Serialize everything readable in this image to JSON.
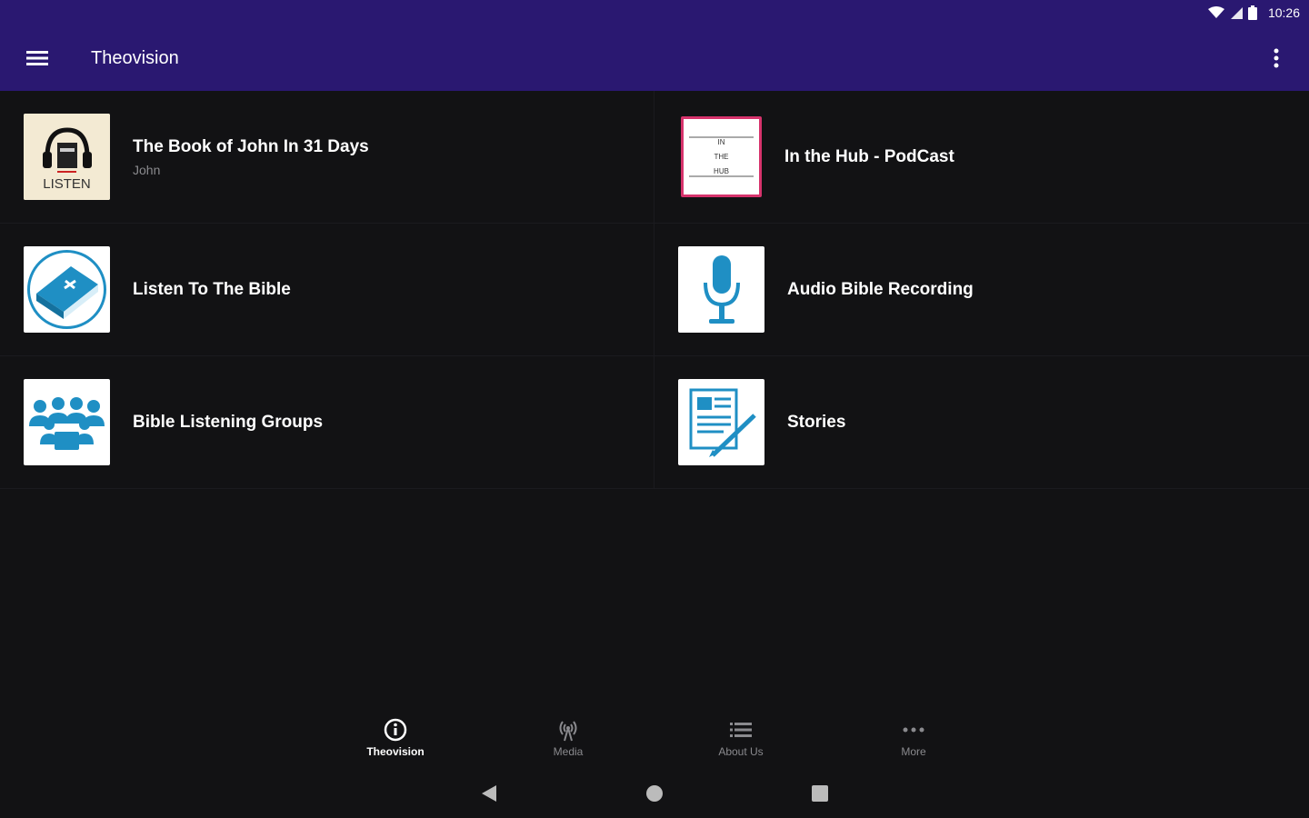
{
  "status_bar": {
    "time": "10:26"
  },
  "app_bar": {
    "title": "Theovision"
  },
  "tiles": [
    {
      "title": "The Book of John In 31 Days",
      "subtitle": "John",
      "thumb_text": "LISTEN"
    },
    {
      "title": "In the Hub - PodCast",
      "subtitle": "",
      "thumb_lines": [
        "IN",
        "THE",
        "HUB"
      ]
    },
    {
      "title": "Listen To The Bible",
      "subtitle": ""
    },
    {
      "title": "Audio Bible Recording",
      "subtitle": ""
    },
    {
      "title": "Bible Listening Groups",
      "subtitle": ""
    },
    {
      "title": "Stories",
      "subtitle": ""
    }
  ],
  "bottom_nav": [
    {
      "label": "Theovision",
      "icon": "info-icon",
      "active": true
    },
    {
      "label": "Media",
      "icon": "broadcast-icon",
      "active": false
    },
    {
      "label": "About Us",
      "icon": "list-icon",
      "active": false
    },
    {
      "label": "More",
      "icon": "more-horiz-icon",
      "active": false
    }
  ],
  "colors": {
    "primary": "#2a1871",
    "background": "#121214",
    "icon_blue": "#1f8fc4",
    "hub_border": "#d6336c"
  }
}
